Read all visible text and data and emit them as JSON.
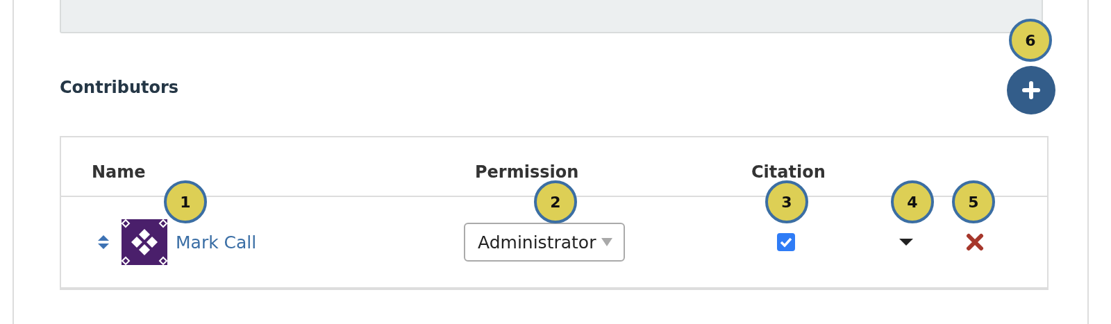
{
  "section": {
    "title": "Contributors"
  },
  "table": {
    "columns": [
      "Name",
      "Permission",
      "Citation"
    ],
    "rows": [
      {
        "name": "Mark Call",
        "permission": "Administrator",
        "citation": true
      }
    ]
  },
  "callouts": [
    "1",
    "2",
    "3",
    "4",
    "5",
    "6"
  ]
}
